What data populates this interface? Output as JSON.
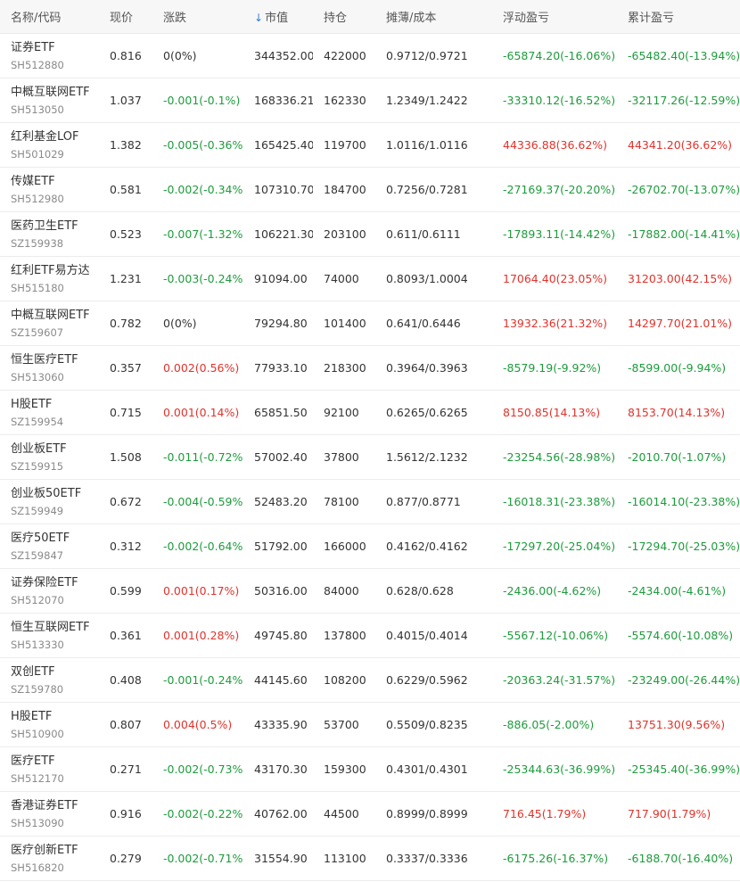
{
  "header": {
    "name_code": "名称/代码",
    "price": "现价",
    "change": "涨跌",
    "market_value": "市值",
    "position": "持仓",
    "cost": "摊薄/成本",
    "floating_pnl": "浮动盈亏",
    "cumulative_pnl": "累计盈亏"
  },
  "colors": {
    "up": "#e0332b",
    "down": "#1e9b3c",
    "sort_arrow": "#2f7fd5"
  },
  "rows": [
    {
      "name": "证券ETF",
      "code": "SH512880",
      "price": "0.816",
      "change": "0(0%)",
      "change_dir": "neutral",
      "market_value": "344352.00",
      "position": "422000",
      "cost": "0.9712/0.9721",
      "floating": "-65874.20(-16.06%)",
      "floating_dir": "green",
      "cumulative": "-65482.40(-13.94%)",
      "cumulative_dir": "green"
    },
    {
      "name": "中概互联网ETF",
      "code": "SH513050",
      "price": "1.037",
      "change": "-0.001(-0.1%)",
      "change_dir": "green",
      "market_value": "168336.21",
      "position": "162330",
      "cost": "1.2349/1.2422",
      "floating": "-33310.12(-16.52%)",
      "floating_dir": "green",
      "cumulative": "-32117.26(-12.59%)",
      "cumulative_dir": "green"
    },
    {
      "name": "红利基金LOF",
      "code": "SH501029",
      "price": "1.382",
      "change": "-0.005(-0.36%)",
      "change_dir": "green",
      "market_value": "165425.40",
      "position": "119700",
      "cost": "1.0116/1.0116",
      "floating": "44336.88(36.62%)",
      "floating_dir": "red",
      "cumulative": "44341.20(36.62%)",
      "cumulative_dir": "red"
    },
    {
      "name": "传媒ETF",
      "code": "SH512980",
      "price": "0.581",
      "change": "-0.002(-0.34%)",
      "change_dir": "green",
      "market_value": "107310.70",
      "position": "184700",
      "cost": "0.7256/0.7281",
      "floating": "-27169.37(-20.20%)",
      "floating_dir": "green",
      "cumulative": "-26702.70(-13.07%)",
      "cumulative_dir": "green"
    },
    {
      "name": "医药卫生ETF",
      "code": "SZ159938",
      "price": "0.523",
      "change": "-0.007(-1.32%)",
      "change_dir": "green",
      "market_value": "106221.30",
      "position": "203100",
      "cost": "0.611/0.6111",
      "floating": "-17893.11(-14.42%)",
      "floating_dir": "green",
      "cumulative": "-17882.00(-14.41%)",
      "cumulative_dir": "green"
    },
    {
      "name": "红利ETF易方达",
      "code": "SH515180",
      "price": "1.231",
      "change": "-0.003(-0.24%)",
      "change_dir": "green",
      "market_value": "91094.00",
      "position": "74000",
      "cost": "0.8093/1.0004",
      "floating": "17064.40(23.05%)",
      "floating_dir": "red",
      "cumulative": "31203.00(42.15%)",
      "cumulative_dir": "red"
    },
    {
      "name": "中概互联网ETF",
      "code": "SZ159607",
      "price": "0.782",
      "change": "0(0%)",
      "change_dir": "neutral",
      "market_value": "79294.80",
      "position": "101400",
      "cost": "0.641/0.6446",
      "floating": "13932.36(21.32%)",
      "floating_dir": "red",
      "cumulative": "14297.70(21.01%)",
      "cumulative_dir": "red"
    },
    {
      "name": "恒生医疗ETF",
      "code": "SH513060",
      "price": "0.357",
      "change": "0.002(0.56%)",
      "change_dir": "red",
      "market_value": "77933.10",
      "position": "218300",
      "cost": "0.3964/0.3963",
      "floating": "-8579.19(-9.92%)",
      "floating_dir": "green",
      "cumulative": "-8599.00(-9.94%)",
      "cumulative_dir": "green"
    },
    {
      "name": "H股ETF",
      "code": "SZ159954",
      "price": "0.715",
      "change": "0.001(0.14%)",
      "change_dir": "red",
      "market_value": "65851.50",
      "position": "92100",
      "cost": "0.6265/0.6265",
      "floating": "8150.85(14.13%)",
      "floating_dir": "red",
      "cumulative": "8153.70(14.13%)",
      "cumulative_dir": "red"
    },
    {
      "name": "创业板ETF",
      "code": "SZ159915",
      "price": "1.508",
      "change": "-0.011(-0.72%)",
      "change_dir": "green",
      "market_value": "57002.40",
      "position": "37800",
      "cost": "1.5612/2.1232",
      "floating": "-23254.56(-28.98%)",
      "floating_dir": "green",
      "cumulative": "-2010.70(-1.07%)",
      "cumulative_dir": "green"
    },
    {
      "name": "创业板50ETF",
      "code": "SZ159949",
      "price": "0.672",
      "change": "-0.004(-0.59%)",
      "change_dir": "green",
      "market_value": "52483.20",
      "position": "78100",
      "cost": "0.877/0.8771",
      "floating": "-16018.31(-23.38%)",
      "floating_dir": "green",
      "cumulative": "-16014.10(-23.38%)",
      "cumulative_dir": "green"
    },
    {
      "name": "医疗50ETF",
      "code": "SZ159847",
      "price": "0.312",
      "change": "-0.002(-0.64%)",
      "change_dir": "green",
      "market_value": "51792.00",
      "position": "166000",
      "cost": "0.4162/0.4162",
      "floating": "-17297.20(-25.04%)",
      "floating_dir": "green",
      "cumulative": "-17294.70(-25.03%)",
      "cumulative_dir": "green"
    },
    {
      "name": "证券保险ETF",
      "code": "SH512070",
      "price": "0.599",
      "change": "0.001(0.17%)",
      "change_dir": "red",
      "market_value": "50316.00",
      "position": "84000",
      "cost": "0.628/0.628",
      "floating": "-2436.00(-4.62%)",
      "floating_dir": "green",
      "cumulative": "-2434.00(-4.61%)",
      "cumulative_dir": "green"
    },
    {
      "name": "恒生互联网ETF",
      "code": "SH513330",
      "price": "0.361",
      "change": "0.001(0.28%)",
      "change_dir": "red",
      "market_value": "49745.80",
      "position": "137800",
      "cost": "0.4015/0.4014",
      "floating": "-5567.12(-10.06%)",
      "floating_dir": "green",
      "cumulative": "-5574.60(-10.08%)",
      "cumulative_dir": "green"
    },
    {
      "name": "双创ETF",
      "code": "SZ159780",
      "price": "0.408",
      "change": "-0.001(-0.24%)",
      "change_dir": "green",
      "market_value": "44145.60",
      "position": "108200",
      "cost": "0.6229/0.5962",
      "floating": "-20363.24(-31.57%)",
      "floating_dir": "green",
      "cumulative": "-23249.00(-26.44%)",
      "cumulative_dir": "green"
    },
    {
      "name": "H股ETF",
      "code": "SH510900",
      "price": "0.807",
      "change": "0.004(0.5%)",
      "change_dir": "red",
      "market_value": "43335.90",
      "position": "53700",
      "cost": "0.5509/0.8235",
      "floating": "-886.05(-2.00%)",
      "floating_dir": "green",
      "cumulative": "13751.30(9.56%)",
      "cumulative_dir": "red"
    },
    {
      "name": "医疗ETF",
      "code": "SH512170",
      "price": "0.271",
      "change": "-0.002(-0.73%)",
      "change_dir": "green",
      "market_value": "43170.30",
      "position": "159300",
      "cost": "0.4301/0.4301",
      "floating": "-25344.63(-36.99%)",
      "floating_dir": "green",
      "cumulative": "-25345.40(-36.99%)",
      "cumulative_dir": "green"
    },
    {
      "name": "香港证券ETF",
      "code": "SH513090",
      "price": "0.916",
      "change": "-0.002(-0.22%)",
      "change_dir": "green",
      "market_value": "40762.00",
      "position": "44500",
      "cost": "0.8999/0.8999",
      "floating": "716.45(1.79%)",
      "floating_dir": "red",
      "cumulative": "717.90(1.79%)",
      "cumulative_dir": "red"
    },
    {
      "name": "医疗创新ETF",
      "code": "SH516820",
      "price": "0.279",
      "change": "-0.002(-0.71%)",
      "change_dir": "green",
      "market_value": "31554.90",
      "position": "113100",
      "cost": "0.3337/0.3336",
      "floating": "-6175.26(-16.37%)",
      "floating_dir": "green",
      "cumulative": "-6188.70(-16.40%)",
      "cumulative_dir": "green"
    }
  ]
}
